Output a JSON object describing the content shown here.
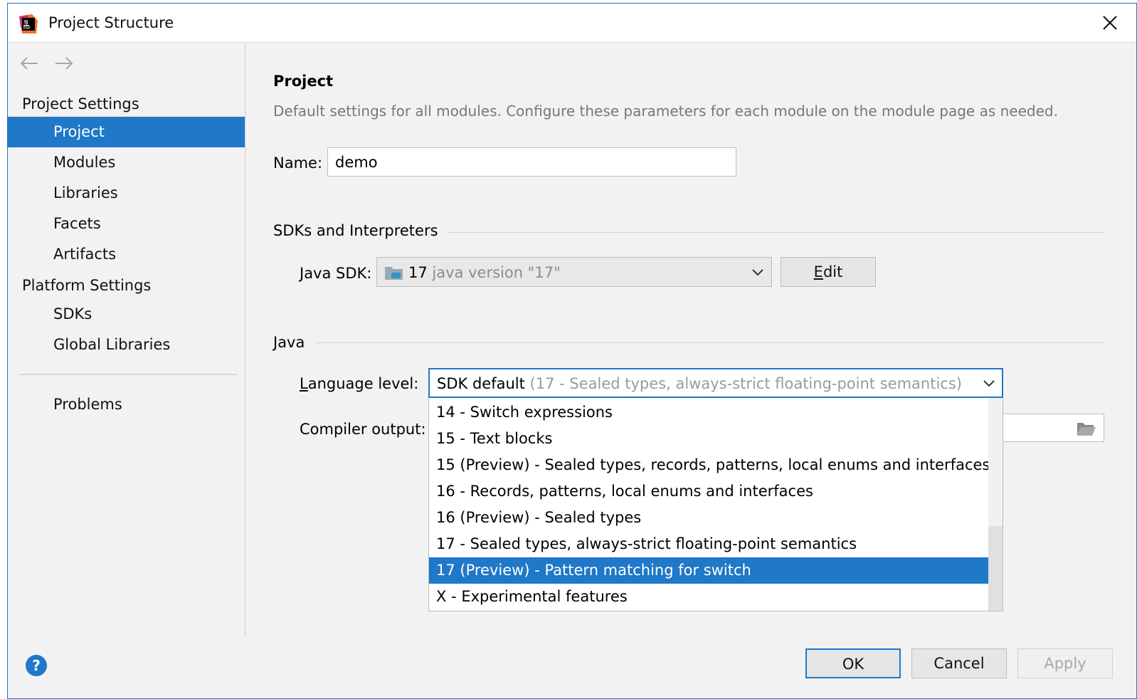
{
  "window": {
    "title": "Project Structure"
  },
  "sidebar": {
    "project_settings_header": "Project Settings",
    "project_items": [
      "Project",
      "Modules",
      "Libraries",
      "Facets",
      "Artifacts"
    ],
    "platform_settings_header": "Platform Settings",
    "platform_items": [
      "SDKs",
      "Global Libraries"
    ],
    "problems": "Problems",
    "selected": "Project"
  },
  "main": {
    "heading": "Project",
    "description": "Default settings for all modules. Configure these parameters for each module on the module page as needed.",
    "name_label": "Name:",
    "name_value": "demo",
    "sdks_group": "SDKs and Interpreters",
    "java_sdk_label": "Java SDK:",
    "java_sdk_name": "17",
    "java_sdk_version": "java version \"17\"",
    "edit_button": "Edit",
    "java_group": "Java",
    "language_level_label": "Language level:",
    "language_level_value": "SDK default",
    "language_level_hint": "(17 - Sealed types, always-strict floating-point semantics)",
    "compiler_output_label": "Compiler output:"
  },
  "dropdown": {
    "options": [
      "14 - Switch expressions",
      "15 - Text blocks",
      "15 (Preview) - Sealed types, records, patterns, local enums and interfaces",
      "16 - Records, patterns, local enums and interfaces",
      "16 (Preview) - Sealed types",
      "17 - Sealed types, always-strict floating-point semantics",
      "17 (Preview) - Pattern matching for switch",
      "X - Experimental features"
    ],
    "highlighted": "17 (Preview) - Pattern matching for switch"
  },
  "footer": {
    "help": "?",
    "ok": "OK",
    "cancel": "Cancel",
    "apply": "Apply"
  },
  "colors": {
    "accent": "#1f78c8",
    "window_bg": "#f2f2f2"
  },
  "icons": {
    "app": "intellij-idea-eap-icon",
    "close": "close-icon",
    "back": "arrow-left-icon",
    "forward": "arrow-right-icon",
    "sdk": "java-sdk-folder-icon",
    "chevron": "chevron-down-icon",
    "browse": "folder-open-icon"
  }
}
